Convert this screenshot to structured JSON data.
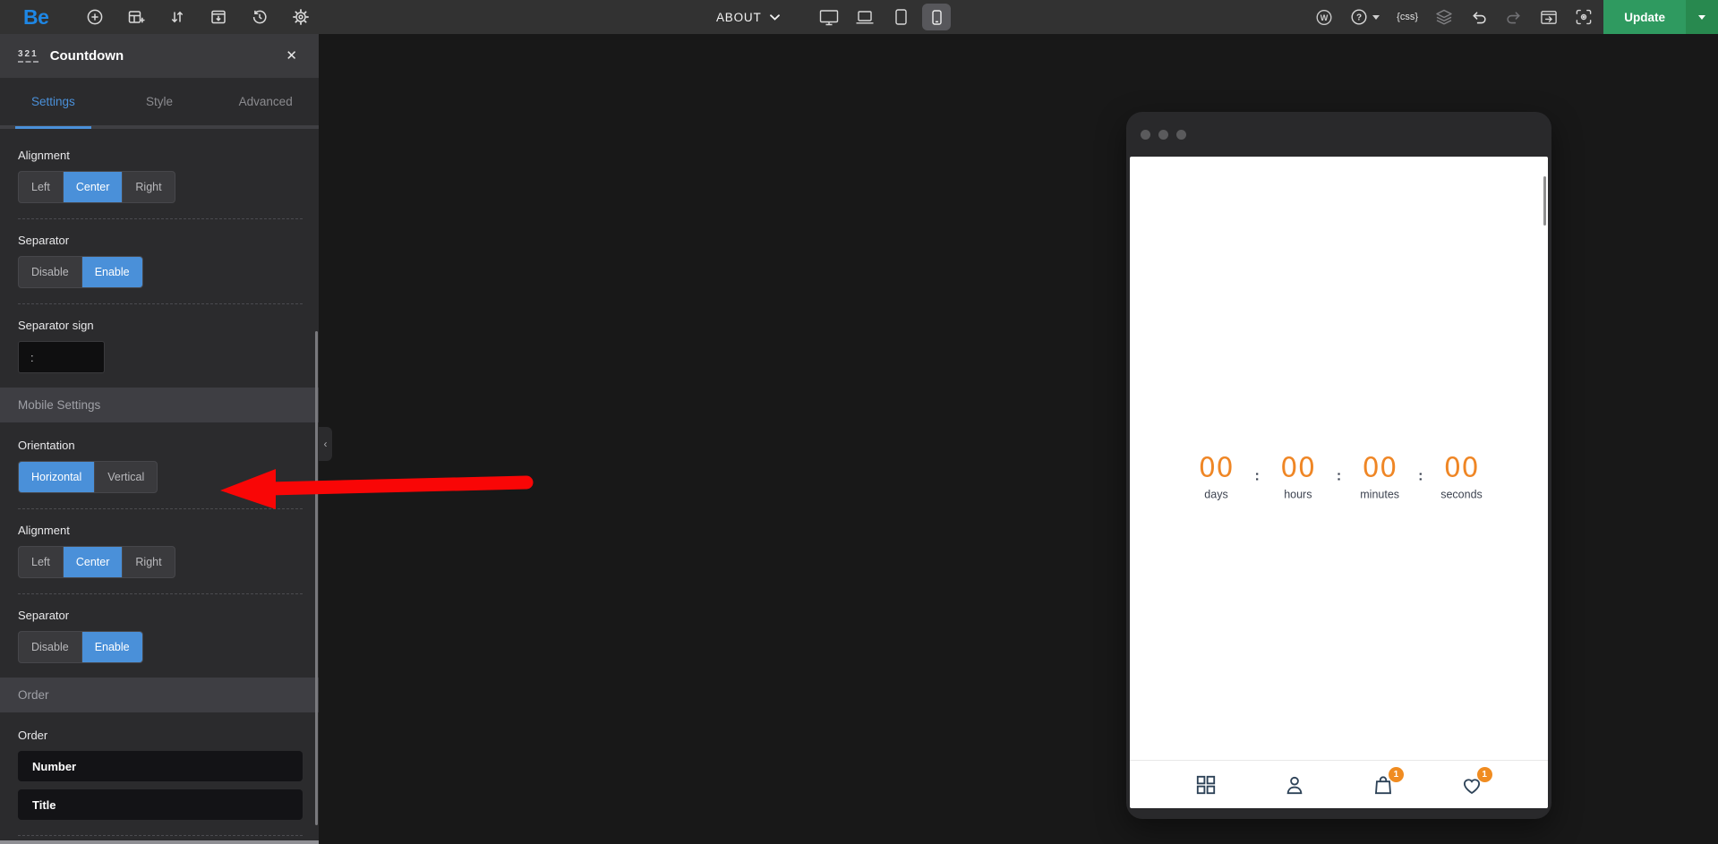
{
  "topbar": {
    "logo": "Be",
    "page_label": "ABOUT",
    "css_chip": "{css}",
    "update_label": "Update"
  },
  "panel": {
    "title": "Countdown",
    "icon_digits": "321",
    "close_glyph": "✕",
    "collapse_glyph": "‹",
    "tabs": {
      "settings": "Settings",
      "style": "Style",
      "advanced": "Advanced"
    },
    "alignment1": {
      "label": "Alignment",
      "left": "Left",
      "center": "Center",
      "right": "Right",
      "selected": "Center"
    },
    "separator1": {
      "label": "Separator",
      "disable": "Disable",
      "enable": "Enable",
      "selected": "Enable"
    },
    "separator_sign": {
      "label": "Separator sign",
      "value": ":"
    },
    "mobile_settings_header": "Mobile Settings",
    "orientation": {
      "label": "Orientation",
      "horizontal": "Horizontal",
      "vertical": "Vertical",
      "selected": "Horizontal"
    },
    "alignment2": {
      "label": "Alignment",
      "left": "Left",
      "center": "Center",
      "right": "Right",
      "selected": "Center"
    },
    "separator2": {
      "label": "Separator",
      "disable": "Disable",
      "enable": "Enable",
      "selected": "Enable"
    },
    "order_header": "Order",
    "order": {
      "label": "Order",
      "item1": "Number",
      "item2": "Title"
    }
  },
  "preview": {
    "countdown": {
      "days_value": "00",
      "days_label": "days",
      "hours_value": "00",
      "hours_label": "hours",
      "minutes_value": "00",
      "minutes_label": "minutes",
      "seconds_value": "00",
      "seconds_label": "seconds",
      "separator": ":"
    },
    "nav": {
      "cart_badge": "1",
      "wishlist_badge": "1"
    }
  },
  "colors": {
    "accent_blue": "#4a90d9",
    "countdown_orange": "#ef8625",
    "badge_orange": "#f08c21",
    "update_green": "#2f9a60",
    "annotation_red": "#f90606",
    "nav_icon_navy": "#2d4257"
  }
}
